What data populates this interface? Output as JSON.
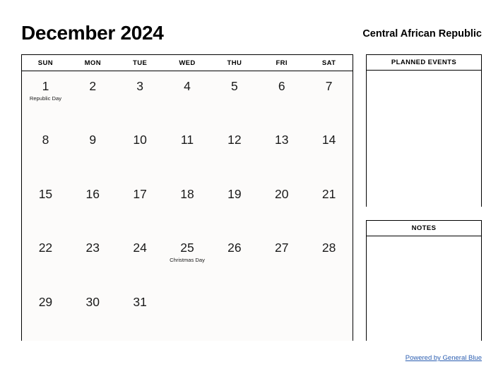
{
  "header": {
    "month_title": "December 2024",
    "country": "Central African Republic"
  },
  "calendar": {
    "weekdays": [
      "SUN",
      "MON",
      "TUE",
      "WED",
      "THU",
      "FRI",
      "SAT"
    ],
    "weeks": [
      [
        {
          "day": "1",
          "event": "Republic Day"
        },
        {
          "day": "2",
          "event": ""
        },
        {
          "day": "3",
          "event": ""
        },
        {
          "day": "4",
          "event": ""
        },
        {
          "day": "5",
          "event": ""
        },
        {
          "day": "6",
          "event": ""
        },
        {
          "day": "7",
          "event": ""
        }
      ],
      [
        {
          "day": "8",
          "event": ""
        },
        {
          "day": "9",
          "event": ""
        },
        {
          "day": "10",
          "event": ""
        },
        {
          "day": "11",
          "event": ""
        },
        {
          "day": "12",
          "event": ""
        },
        {
          "day": "13",
          "event": ""
        },
        {
          "day": "14",
          "event": ""
        }
      ],
      [
        {
          "day": "15",
          "event": ""
        },
        {
          "day": "16",
          "event": ""
        },
        {
          "day": "17",
          "event": ""
        },
        {
          "day": "18",
          "event": ""
        },
        {
          "day": "19",
          "event": ""
        },
        {
          "day": "20",
          "event": ""
        },
        {
          "day": "21",
          "event": ""
        }
      ],
      [
        {
          "day": "22",
          "event": ""
        },
        {
          "day": "23",
          "event": ""
        },
        {
          "day": "24",
          "event": ""
        },
        {
          "day": "25",
          "event": "Christmas Day"
        },
        {
          "day": "26",
          "event": ""
        },
        {
          "day": "27",
          "event": ""
        },
        {
          "day": "28",
          "event": ""
        }
      ],
      [
        {
          "day": "29",
          "event": ""
        },
        {
          "day": "30",
          "event": ""
        },
        {
          "day": "31",
          "event": ""
        },
        {
          "day": "",
          "event": ""
        },
        {
          "day": "",
          "event": ""
        },
        {
          "day": "",
          "event": ""
        },
        {
          "day": "",
          "event": ""
        }
      ]
    ]
  },
  "panels": {
    "planned_events": {
      "title": "PLANNED EVENTS",
      "content": ""
    },
    "notes": {
      "title": "NOTES",
      "content": ""
    }
  },
  "footer": {
    "link_text": "Powered by General Blue"
  },
  "colors": {
    "link": "#2a5db0",
    "border": "#000000",
    "day_cell_background": "#fcfbfa",
    "page_background": "#ffffff"
  }
}
